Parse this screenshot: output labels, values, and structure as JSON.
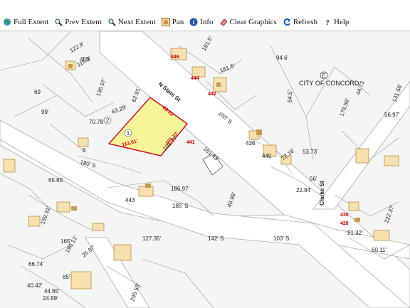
{
  "toolbar": {
    "full_extent": "Full Extent",
    "prev_extent": "Prev Extent",
    "next_extent": "Next Extent",
    "pan": "Pan",
    "info": "Info",
    "clear_graphics": "Clear Graphics",
    "refresh": "Refresh",
    "help": "Help"
  },
  "map": {
    "street_n_state": "N State St",
    "street_clarke": "Clarke St",
    "city_label": "CITY OF CONCORD",
    "city_marker": "E",
    "parcel_marker": "1",
    "parcel_marker_2": "2",
    "parcel_dim_top": "63.12'",
    "parcel_dim_left": "113.51'",
    "parcel_dim_right": "101.77'",
    "parcel_dim_a": "63.29'",
    "parcel_dim_b": "62.91'",
    "parcel_dim_c": "101.77'",
    "address_441": "441",
    "address_442": "442",
    "address_444": "444",
    "address_446": "446",
    "address_443": "443",
    "address_453": "453",
    "address_430": "430",
    "address_428": "428",
    "address_436": "436",
    "address_440": "440",
    "address_6": "6",
    "dim_161": "161.43'",
    "dim_186": "186.97'",
    "dim_185": "185' S",
    "dim_180": "180' S",
    "dim_127": "127.35'",
    "dim_142": "142' S",
    "dim_103": "103' S",
    "dim_100": "100' S",
    "dim_181": "181.5'",
    "dim_181b": "181.5'",
    "dim_178": "178.58'",
    "dim_72": "72.16'",
    "dim_53": "53.73'",
    "dim_56": "56'",
    "dim_44": "44.73",
    "dim_94": "94.6'",
    "dim_84": "84.5'",
    "dim_69": "69",
    "dim_99": "99'",
    "dim_70": "70.78",
    "dim_136": "136.97'",
    "dim_122": "122.8'",
    "dim_116": "116.5'",
    "dim_131": "131.56'",
    "dim_56b": "56.97'",
    "dim_222": "222.37'",
    "dim_91": "91.32'",
    "dim_60": "60.11'",
    "dim_165": "165'",
    "dim_159": "159.31'",
    "dim_65": "65.65'",
    "dim_190": "190.12'",
    "dim_66": "66.74'",
    "dim_25": "25.97'",
    "dim_40": "40.42'",
    "dim_44b": "44.65'",
    "dim_24": "24.89'",
    "dim_295": "295.53'",
    "dim_85": "85'",
    "dim_40b": "40.96'",
    "dim_22": "22.84'"
  }
}
